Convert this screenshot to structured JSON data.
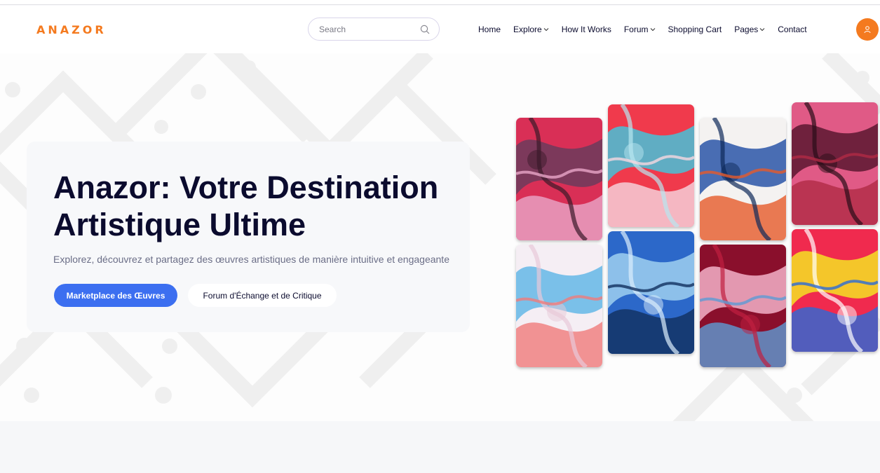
{
  "header": {
    "logo": "ANAZOR",
    "search": {
      "placeholder": "Search",
      "value": ""
    },
    "nav": [
      {
        "label": "Home",
        "dropdown": false
      },
      {
        "label": "Explore",
        "dropdown": true
      },
      {
        "label": "How It Works",
        "dropdown": false
      },
      {
        "label": "Forum",
        "dropdown": true
      },
      {
        "label": "Shopping Cart",
        "dropdown": false
      },
      {
        "label": "Pages",
        "dropdown": true
      },
      {
        "label": "Contact",
        "dropdown": false
      }
    ],
    "user_icon": "user-icon"
  },
  "hero": {
    "title": "Anazor: Votre Destination Artistique Ultime",
    "subtitle": "Explorez, découvrez et partagez des œuvres artistiques de manière intuitive et engageante",
    "primary_button": "Marketplace des Œuvres",
    "secondary_button": "Forum d'Échange et de Critique"
  },
  "gallery": [
    {
      "name": "artwork-pink-red-marble",
      "colors": [
        "#d92f56",
        "#6b3b5c",
        "#e8a6c8",
        "#3a1a2a"
      ]
    },
    {
      "name": "artwork-red-cyan-swirl",
      "colors": [
        "#f03a4c",
        "#47c2d8",
        "#f6d7e0",
        "#b8e6ef"
      ]
    },
    {
      "name": "artwork-white-blue-orange",
      "colors": [
        "#f4f2f1",
        "#2a56a8",
        "#e65a2a",
        "#0e2a5a"
      ]
    },
    {
      "name": "artwork-pink-maroon-marble",
      "colors": [
        "#e05a86",
        "#5b1830",
        "#b02a45",
        "#2a0d18"
      ]
    },
    {
      "name": "artwork-pastel-marble",
      "colors": [
        "#f5eef4",
        "#64b7e6",
        "#f07b7b",
        "#e8c9d8"
      ]
    },
    {
      "name": "artwork-blue-portrait",
      "colors": [
        "#2c68c9",
        "#9fd0f0",
        "#12305f",
        "#dbeefc"
      ]
    },
    {
      "name": "artwork-crimson-pink",
      "colors": [
        "#8a0f2c",
        "#f2b0c8",
        "#5c9bd5",
        "#c02040"
      ]
    },
    {
      "name": "artwork-red-yellow-fluid",
      "colors": [
        "#f02a4e",
        "#f5e224",
        "#2a6ad8",
        "#ffffff"
      ]
    }
  ],
  "colors": {
    "accent": "#f47a1f",
    "primary": "#3c6ff0",
    "text": "#0b0b2e",
    "muted": "#6b6e87"
  }
}
